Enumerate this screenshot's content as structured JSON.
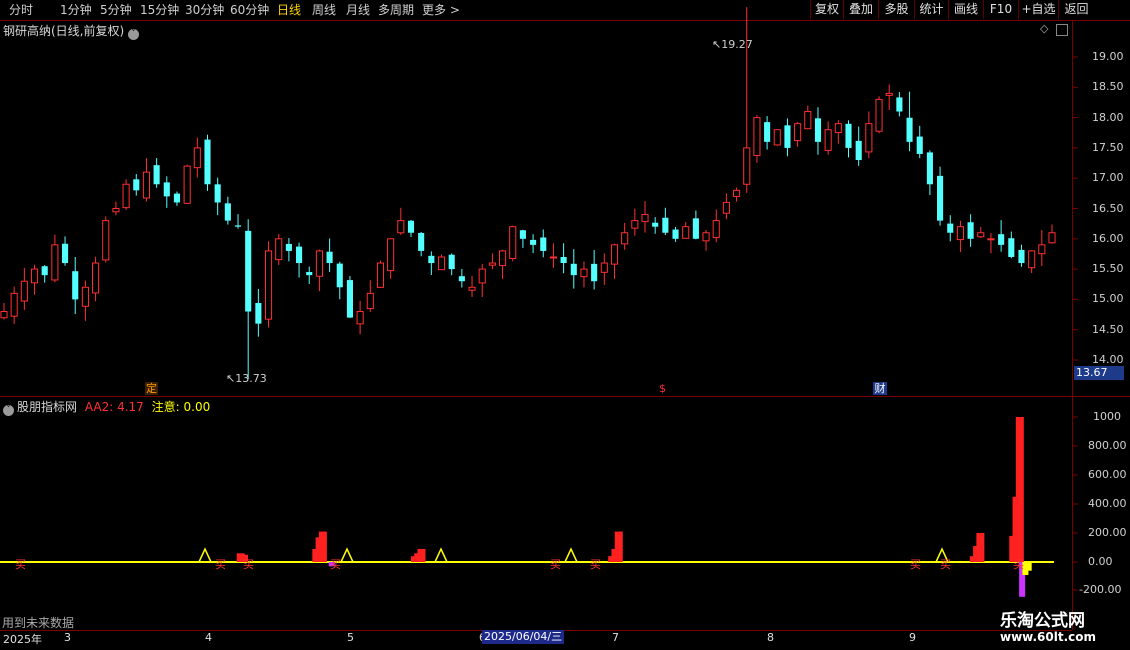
{
  "toolbar": {
    "periods": [
      "分时",
      "1分钟",
      "5分钟",
      "15分钟",
      "30分钟",
      "60分钟",
      "日线",
      "周线",
      "月线",
      "多周期",
      "更多 >"
    ],
    "active_period": "日线",
    "right_buttons": [
      "复权",
      "叠加",
      "多股",
      "统计",
      "画线",
      "F10",
      "+自选",
      "返回"
    ]
  },
  "main_chart": {
    "title": "钢研高纳(日线,前复权)",
    "price_levels": [
      "19.00",
      "18.50",
      "18.00",
      "17.50",
      "17.00",
      "16.50",
      "16.00",
      "15.50",
      "15.00",
      "14.50",
      "14.00"
    ],
    "current_price_tag": "13.67",
    "high_label": "19.27",
    "low_label": "13.73",
    "event_markers": [
      {
        "text": "定",
        "color": "#ff9900"
      },
      {
        "text": "$",
        "color": "#ff3030"
      },
      {
        "text": "财",
        "color": "#ffffff"
      }
    ]
  },
  "indicator": {
    "name": "股朋指标网",
    "aa2": "AA2: 4.17",
    "attention": "注意: 0.00",
    "levels": [
      "1000",
      "800.00",
      "600.00",
      "400.00",
      "200.00",
      "0.00",
      "-200.00"
    ],
    "buy_label": "买",
    "colors": {
      "up": "#ff2020",
      "down": "#ffff00",
      "zero_line": "#ffff00"
    }
  },
  "footer": {
    "future_data": "用到未来数据",
    "year_label": "2025年",
    "months": [
      "3",
      "4",
      "5",
      "6",
      "7",
      "8",
      "9"
    ],
    "date_cursor": "2025/06/04/三"
  },
  "watermark": {
    "title": "乐淘公式网",
    "url": "www.60lt.com"
  },
  "chart_data": {
    "type": "candlestick",
    "title": "钢研高纳(日线,前复权)",
    "ylim": [
      13.67,
      19.3
    ],
    "high": 19.27,
    "low": 13.73,
    "close": [
      14.8,
      15.1,
      15.3,
      15.5,
      15.4,
      15.9,
      15.6,
      15.0,
      15.2,
      15.6,
      16.3,
      16.5,
      16.9,
      16.8,
      17.1,
      16.9,
      16.7,
      16.6,
      17.2,
      17.5,
      16.9,
      16.6,
      16.3,
      16.2,
      14.8,
      14.6,
      15.8,
      16.0,
      15.8,
      15.6,
      15.4,
      15.8,
      15.6,
      15.2,
      14.7,
      14.8,
      15.1,
      15.6,
      16.0,
      16.3,
      16.1,
      15.8,
      15.6,
      15.7,
      15.5,
      15.3,
      15.2,
      15.5,
      15.6,
      15.8,
      16.2,
      16.0,
      15.9,
      15.8,
      15.7,
      15.6,
      15.4,
      15.5,
      15.3,
      15.6,
      15.9,
      16.1,
      16.3,
      16.4,
      16.2,
      16.1,
      16.0,
      16.2,
      16.0,
      16.1,
      16.3,
      16.6,
      16.8,
      17.5,
      18.0,
      17.6,
      17.8,
      17.5,
      17.9,
      18.1,
      17.6,
      17.8,
      17.9,
      17.5,
      17.3,
      17.9,
      18.3,
      18.4,
      18.1,
      17.6,
      17.4,
      16.9,
      16.3,
      16.1,
      16.2,
      16.0,
      16.1,
      16.0,
      15.9,
      15.7,
      15.6,
      15.8,
      15.9,
      16.1
    ],
    "volume_signal": [
      0,
      0,
      0,
      0,
      0,
      0,
      0,
      0,
      0,
      0,
      0,
      0,
      0,
      0,
      0,
      0,
      0,
      0,
      0,
      0,
      0,
      0,
      0,
      0,
      0,
      0,
      0,
      0,
      0,
      0,
      0,
      0,
      0,
      0,
      0,
      0,
      0,
      0,
      0,
      0,
      0,
      0,
      0,
      0,
      0,
      0,
      0,
      0,
      0,
      0,
      0,
      0,
      0,
      0,
      0,
      0,
      0,
      0,
      0,
      0,
      0,
      0,
      0,
      0,
      0,
      0,
      0,
      0,
      0,
      0,
      0,
      0,
      0,
      0,
      0,
      0,
      0,
      0,
      0,
      0,
      0,
      0,
      0,
      0,
      0,
      0,
      0,
      0,
      0,
      0,
      0,
      0,
      0,
      0,
      0,
      0,
      0,
      0,
      0,
      0,
      0,
      0,
      0,
      0
    ],
    "signal_bars": [
      {
        "x_day": 72,
        "value": 60
      },
      {
        "x_day": 73,
        "value": 50
      },
      {
        "x_day": 95,
        "value": 90
      },
      {
        "x_day": 96,
        "value": 170
      },
      {
        "x_day": 97,
        "value": 210
      },
      {
        "x_day": 125,
        "value": 40
      },
      {
        "x_day": 126,
        "value": 60
      },
      {
        "x_day": 127,
        "value": 90
      },
      {
        "x_day": 185,
        "value": 40
      },
      {
        "x_day": 186,
        "value": 90
      },
      {
        "x_day": 187,
        "value": 210
      },
      {
        "x_day": 295,
        "value": 40
      },
      {
        "x_day": 296,
        "value": 110
      },
      {
        "x_day": 297,
        "value": 200
      },
      {
        "x_day": 307,
        "value": 180
      },
      {
        "x_day": 308,
        "value": 450
      },
      {
        "x_day": 309,
        "value": 1000
      }
    ],
    "neg_bars": [
      {
        "x_day": 100,
        "value": -30
      },
      {
        "x_day": 310,
        "value": -240
      },
      {
        "x_day": 311,
        "value": -90
      },
      {
        "x_day": 312,
        "value": -60
      }
    ],
    "x_months": [
      "3",
      "4",
      "5",
      "6",
      "7",
      "8",
      "9"
    ]
  }
}
